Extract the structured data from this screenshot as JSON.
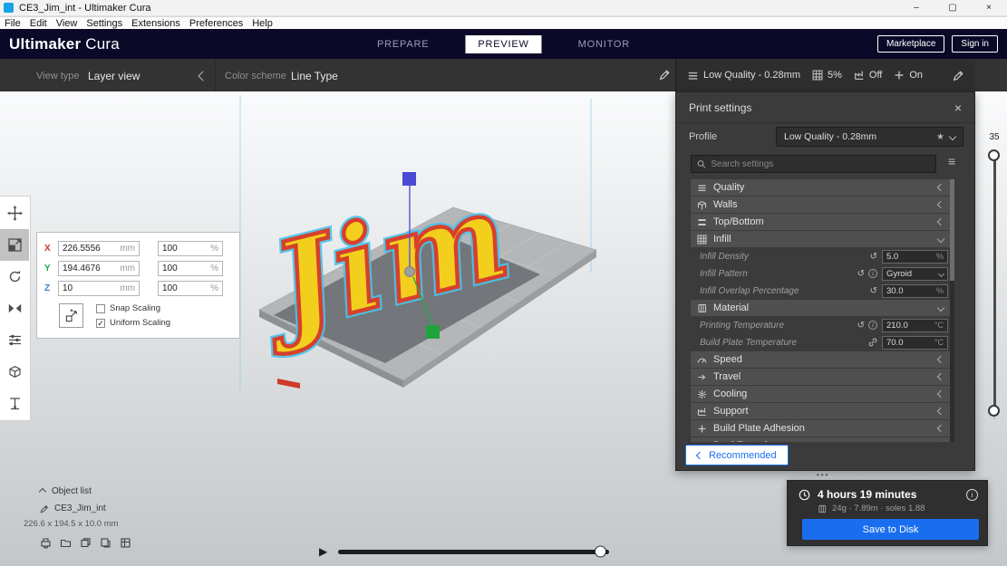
{
  "colors": {
    "accent": "#196ef0",
    "header-bg": "#0a0a28",
    "panel-bg": "#3b3b3b",
    "panel-row": "#4f4f4f",
    "model-yellow": "#f2cf1d",
    "model-red": "#d6402c",
    "model-halo": "#49c3ec"
  },
  "icons": {
    "minimize": "–",
    "maximize": "▢",
    "close": "×",
    "star": "★",
    "check": "✓",
    "reset": "↺",
    "info": "i",
    "menu_lines": "≡",
    "play": "▶",
    "ellipsis": "•••"
  },
  "titlebar": {
    "title": "CE3_Jim_int - Ultimaker Cura"
  },
  "menubar": {
    "items": [
      "File",
      "Edit",
      "View",
      "Settings",
      "Extensions",
      "Preferences",
      "Help"
    ]
  },
  "header": {
    "brand_bold": "Ultimaker",
    "brand_light": "Cura",
    "tabs": [
      {
        "label": "PREPARE"
      },
      {
        "label": "PREVIEW"
      },
      {
        "label": "MONITOR"
      }
    ],
    "active_tab": "PREVIEW",
    "marketplace_label": "Marketplace",
    "signin_label": "Sign in"
  },
  "viewbar": {
    "view_type_label": "View type",
    "view_type_value": "Layer view",
    "color_scheme_label": "Color scheme",
    "color_scheme_value": "Line Type"
  },
  "settings_summary": {
    "profile": "Low Quality - 0.28mm",
    "infill": "5%",
    "support": "Off",
    "adhesion": "On"
  },
  "print_settings": {
    "title": "Print settings",
    "profile_label": "Profile",
    "profile_value": "Low Quality - 0.28mm",
    "search_placeholder": "Search settings",
    "categories": [
      {
        "label": "Quality"
      },
      {
        "label": "Walls"
      },
      {
        "label": "Top/Bottom"
      },
      {
        "label": "Infill"
      },
      {
        "label": "Material"
      },
      {
        "label": "Speed"
      },
      {
        "label": "Travel"
      },
      {
        "label": "Cooling"
      },
      {
        "label": "Support"
      },
      {
        "label": "Build Plate Adhesion"
      },
      {
        "label": "Dual Extrusion"
      }
    ],
    "infill_settings": [
      {
        "label": "Infill Density",
        "value": "5.0",
        "unit": "%"
      },
      {
        "label": "Infill Pattern",
        "value": "Gyroid",
        "unit": ""
      },
      {
        "label": "Infill Overlap Percentage",
        "value": "30.0",
        "unit": "%"
      }
    ],
    "material_settings": [
      {
        "label": "Printing Temperature",
        "value": "210.0",
        "unit": "°C"
      },
      {
        "label": "Build Plate Temperature",
        "value": "70.0",
        "unit": "°C"
      }
    ],
    "recommended_label": "Recommended"
  },
  "scale_panel": {
    "axes": [
      {
        "axis": "X",
        "size": "226.5556",
        "size_unit": "mm",
        "pct": "100",
        "pct_unit": "%"
      },
      {
        "axis": "Y",
        "size": "194.4676",
        "size_unit": "mm",
        "pct": "100",
        "pct_unit": "%"
      },
      {
        "axis": "Z",
        "size": "10",
        "size_unit": "mm",
        "pct": "100",
        "pct_unit": "%"
      }
    ],
    "snap_label": "Snap Scaling",
    "uniform_label": "Uniform Scaling"
  },
  "object_list": {
    "toggle_label": "Object list",
    "item_name": "CE3_Jim_int",
    "dimensions": "226.6 x 194.5 x 10.0 mm"
  },
  "action_panel": {
    "time_estimate": "4 hours 19 minutes",
    "material_estimate": "24g · 7.89m · soles 1.88",
    "save_label": "Save to Disk"
  },
  "layer_slider": {
    "top_value": "35"
  },
  "scene": {
    "model_text": "Jim"
  }
}
